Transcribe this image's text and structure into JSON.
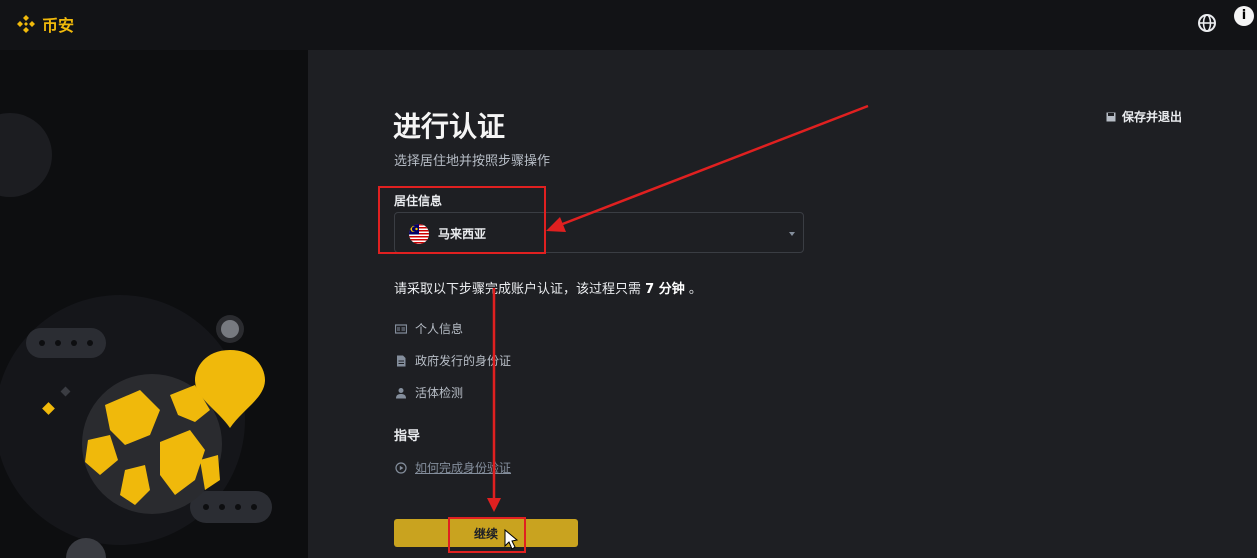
{
  "header": {
    "brand_name": "币安",
    "globe_icon": "globe-icon",
    "info_label": "i"
  },
  "page": {
    "title": "进行认证",
    "subtitle": "选择居住地并按照步骤操作",
    "save_exit_label": "保存并退出"
  },
  "residence": {
    "label": "居住信息",
    "selected_country": "马来西亚",
    "flag_icon": "malaysia-flag-icon"
  },
  "instructions": {
    "prefix": "请采取以下步骤完成账户认证，该过程只需",
    "time": "7 分钟",
    "suffix": "。"
  },
  "steps": [
    {
      "label": "个人信息",
      "icon": "id-card-icon"
    },
    {
      "label": "政府发行的身份证",
      "icon": "document-icon"
    },
    {
      "label": "活体检测",
      "icon": "person-icon"
    }
  ],
  "guide": {
    "title": "指导",
    "link_label": "如何完成身份验证",
    "icon": "play-circle-icon"
  },
  "continue_label": "继续",
  "colors": {
    "brand": "#F0B90B",
    "button": "#c9a31f",
    "annotation": "#e02020"
  }
}
